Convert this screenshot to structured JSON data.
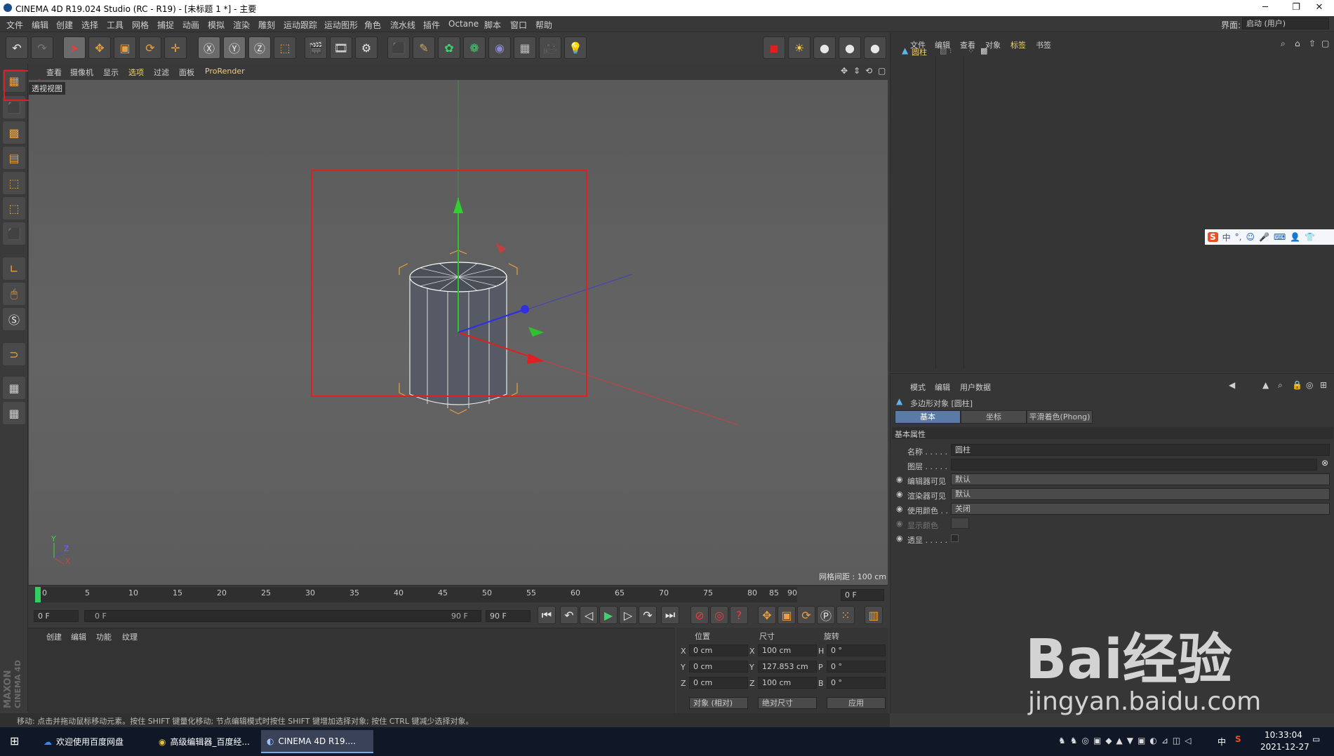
{
  "window": {
    "title": "CINEMA 4D R19.024 Studio (RC - R19) - [未标题 1 *] - 主要"
  },
  "menu": [
    "文件",
    "编辑",
    "创建",
    "选择",
    "工具",
    "网格",
    "捕捉",
    "动画",
    "模拟",
    "渲染",
    "雕刻",
    "运动跟踪",
    "运动图形",
    "角色",
    "流水线",
    "插件",
    "Octane",
    "脚本",
    "窗口",
    "帮助"
  ],
  "layout": {
    "label": "界面:",
    "value": "启动 (用户)"
  },
  "viewport": {
    "menu": [
      "查看",
      "摄像机",
      "显示",
      "选项",
      "过滤",
      "面板",
      "ProRender"
    ],
    "name": "透视视图",
    "grid_spacing": "网格间距 : 100 cm",
    "axis_labels": {
      "y": "Y",
      "z": "Z",
      "x": "X"
    }
  },
  "timeline": {
    "ticks": [
      "0",
      "5",
      "10",
      "15",
      "20",
      "25",
      "30",
      "35",
      "40",
      "45",
      "50",
      "55",
      "60",
      "65",
      "70",
      "75",
      "80",
      "85",
      "90"
    ],
    "current": "0 F",
    "start": "0 F",
    "range_start": "0 F",
    "range_end": "90 F",
    "end": "90 F"
  },
  "material_panel": {
    "menu": [
      "创建",
      "编辑",
      "功能",
      "纹理"
    ]
  },
  "coords": {
    "headers": [
      "位置",
      "尺寸",
      "旋转"
    ],
    "rows": [
      {
        "axis": "X",
        "pos": "0 cm",
        "size_axis": "X",
        "size": "100 cm",
        "rot_axis": "H",
        "rot": "0 °"
      },
      {
        "axis": "Y",
        "pos": "0 cm",
        "size_axis": "Y",
        "size": "127.853 cm",
        "rot_axis": "P",
        "rot": "0 °"
      },
      {
        "axis": "Z",
        "pos": "0 cm",
        "size_axis": "Z",
        "size": "100 cm",
        "rot_axis": "B",
        "rot": "0 °"
      }
    ],
    "mode": "对象 (相对)",
    "size_mode": "绝对尺寸",
    "apply": "应用"
  },
  "object_manager": {
    "menu": [
      "文件",
      "编辑",
      "查看",
      "对象",
      "标签",
      "书签"
    ],
    "objects": [
      {
        "name": "圆柱"
      }
    ]
  },
  "attributes": {
    "menu": [
      "模式",
      "编辑",
      "用户数据"
    ],
    "object_title": "多边形对象 [圆柱]",
    "tabs": [
      "基本",
      "坐标",
      "平滑着色(Phong)"
    ],
    "section": "基本属性",
    "fields": {
      "name_label": "名称 . . . . .",
      "name_value": "圆柱",
      "layer_label": "图层 . . . . .",
      "editor_label": "编辑器可见",
      "editor_value": "默认",
      "render_label": "渲染器可见",
      "render_value": "默认",
      "color_label": "使用颜色 . .",
      "color_value": "关闭",
      "display_color_label": "显示颜色",
      "xray_label": "透显 . . . . ."
    }
  },
  "ime": {
    "items": [
      "中",
      "°,"
    ]
  },
  "statusbar": {
    "text": "移动: 点击并拖动鼠标移动元素。按住 SHIFT 键量化移动; 节点编辑模式时按住 SHIFT 键增加选择对象; 按住 CTRL 键减少选择对象。"
  },
  "side_logo": {
    "brand": "MAXON",
    "product": "CINEMA 4D"
  },
  "taskbar": {
    "apps": [
      "欢迎使用百度网盘",
      "高级编辑器_百度经...",
      "CINEMA 4D R19...."
    ],
    "time": "10:33:04",
    "date": "2021-12-27",
    "ime": "中"
  },
  "watermark": {
    "brand": "Bai经验",
    "url": "jingyan.baidu.com"
  },
  "colors": {
    "accent": "#e8a040",
    "red_highlight": "#e02020",
    "bg": "#3b3b3b"
  }
}
